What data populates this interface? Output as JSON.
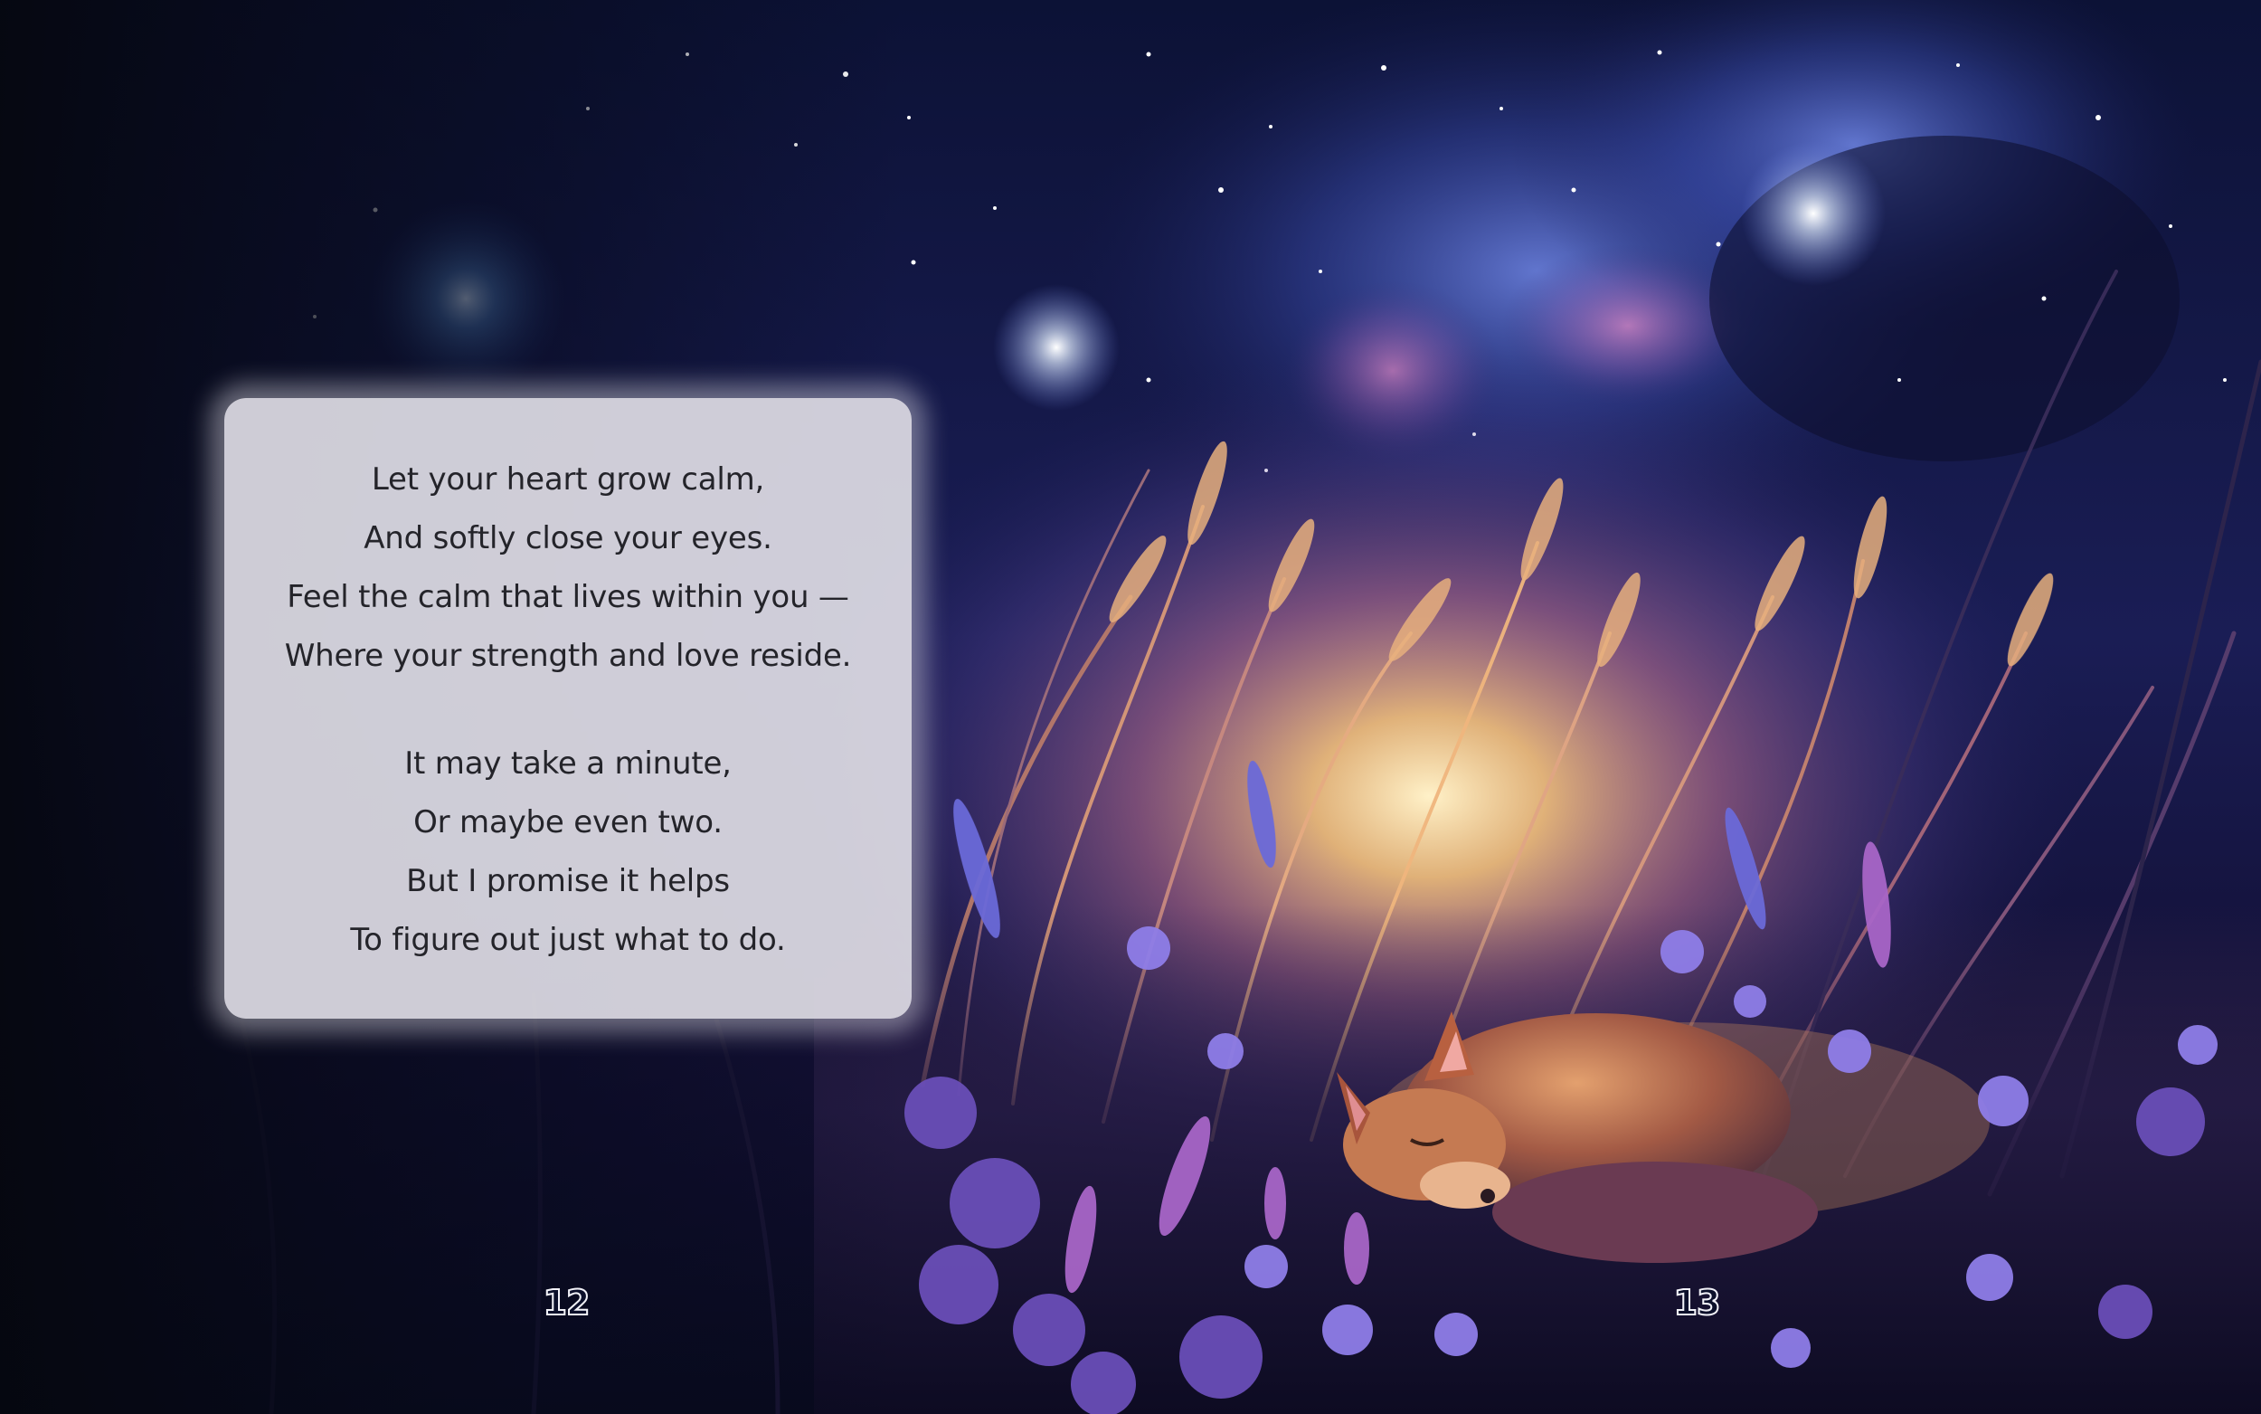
{
  "poem": {
    "stanzas": [
      {
        "lines": [
          "Let your heart grow calm,",
          "And softly close your eyes.",
          "Feel the calm that lives within you —",
          "Where your strength and love reside."
        ]
      },
      {
        "lines": [
          "It may take a minute,",
          "Or maybe even two.",
          "But I promise it helps",
          "To figure out just what to do."
        ]
      }
    ]
  },
  "pages": {
    "left_number": "12",
    "right_number": "13"
  },
  "illustration": {
    "subject": "sleeping fox curled in tall grass and wildflowers under a starry night sky",
    "colors": {
      "sky": "#0b1030",
      "nebula": "#3a4fae",
      "glow": "#f4c27a",
      "flowers": "#8a78e6",
      "fox": "#b86a48"
    }
  }
}
